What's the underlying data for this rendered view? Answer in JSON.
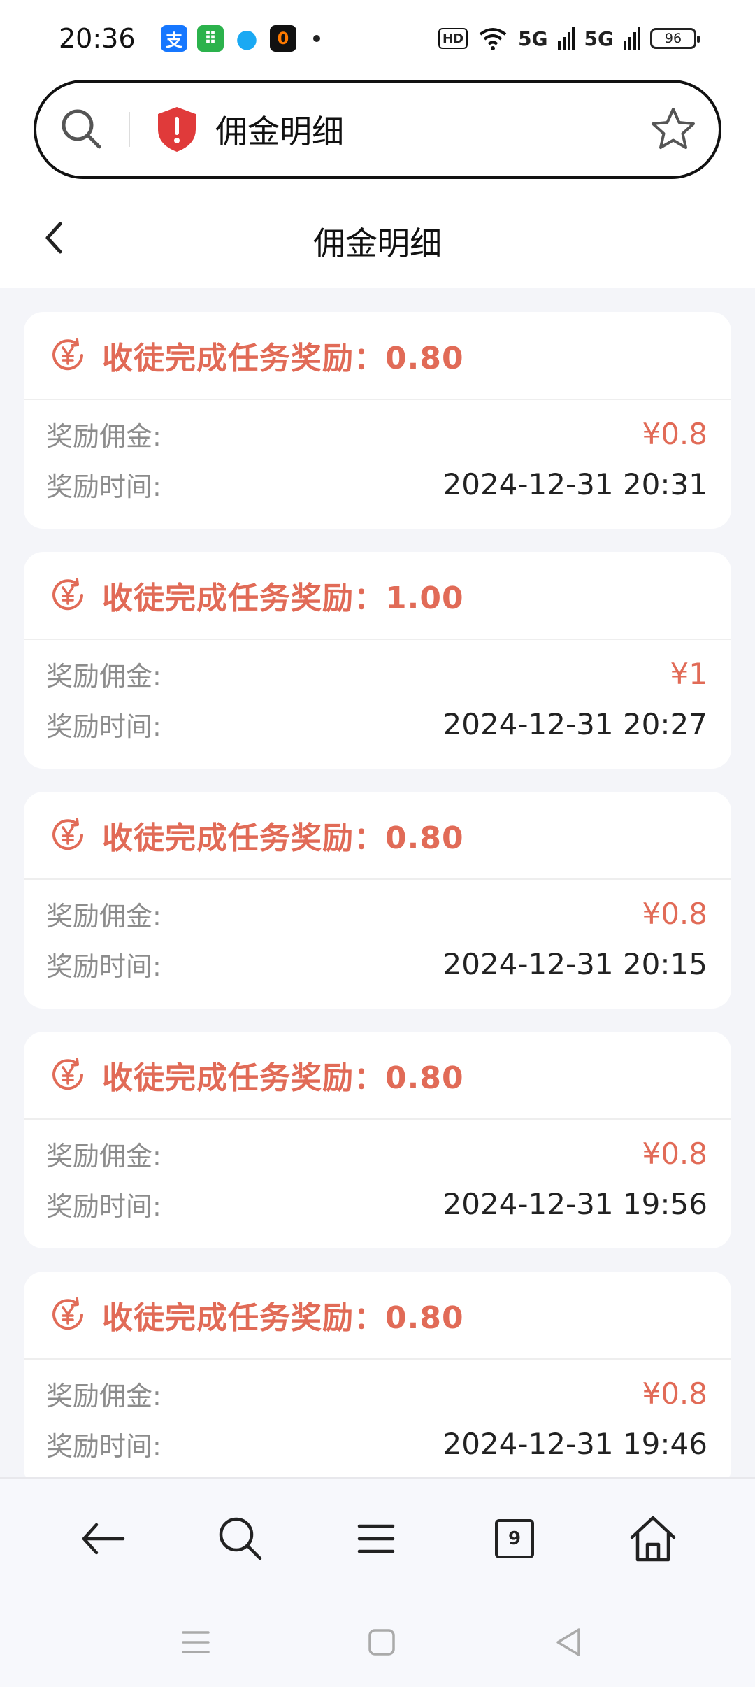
{
  "status_bar": {
    "time": "20:36",
    "apps": [
      {
        "icon": "alipay-icon",
        "glyph": "支"
      },
      {
        "icon": "android-app-icon",
        "glyph": "⠿"
      },
      {
        "icon": "qq-icon",
        "glyph": "●"
      },
      {
        "icon": "app-icon",
        "glyph": "0"
      }
    ],
    "hd": "HD",
    "signal_1": "5G",
    "signal_2": "5G",
    "battery": "96"
  },
  "search": {
    "text": "佣金明细"
  },
  "header": {
    "title": "佣金明细"
  },
  "records": [
    {
      "title": "收徒完成任务奖励：0.80",
      "amount_label": "奖励佣金:",
      "amount": "¥0.8",
      "time_label": "奖励时间:",
      "time": "2024-12-31 20:31"
    },
    {
      "title": "收徒完成任务奖励：1.00",
      "amount_label": "奖励佣金:",
      "amount": "¥1",
      "time_label": "奖励时间:",
      "time": "2024-12-31 20:27"
    },
    {
      "title": "收徒完成任务奖励：0.80",
      "amount_label": "奖励佣金:",
      "amount": "¥0.8",
      "time_label": "奖励时间:",
      "time": "2024-12-31 20:15"
    },
    {
      "title": "收徒完成任务奖励：0.80",
      "amount_label": "奖励佣金:",
      "amount": "¥0.8",
      "time_label": "奖励时间:",
      "time": "2024-12-31 19:56"
    },
    {
      "title": "收徒完成任务奖励：0.80",
      "amount_label": "奖励佣金:",
      "amount": "¥0.8",
      "time_label": "奖励时间:",
      "time": "2024-12-31 19:46"
    }
  ],
  "bottom_nav": {
    "tab_count": "9"
  },
  "colors": {
    "accent": "#e16b57",
    "background": "#f4f5f9"
  }
}
